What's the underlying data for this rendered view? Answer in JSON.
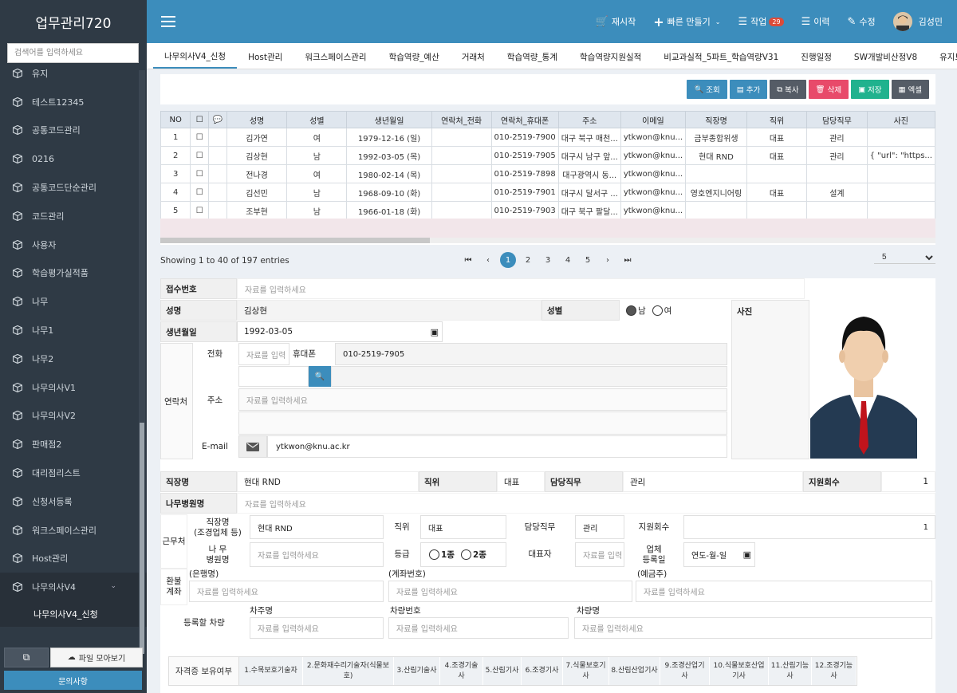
{
  "app": {
    "title": "업무관리720",
    "search_placeholder": "검색어를 입력하세요"
  },
  "sidebar": {
    "items": [
      {
        "label": "유지"
      },
      {
        "label": "테스트12345"
      },
      {
        "label": "공통코드관리"
      },
      {
        "label": "0216"
      },
      {
        "label": "공통코드단순관리"
      },
      {
        "label": "코드관리"
      },
      {
        "label": "사용자"
      },
      {
        "label": "학습평가실적품"
      },
      {
        "label": "나무"
      },
      {
        "label": "나무1"
      },
      {
        "label": "나무2"
      },
      {
        "label": "나무의사V1"
      },
      {
        "label": "나무의사V2"
      },
      {
        "label": "판매점2"
      },
      {
        "label": "대리점리스트"
      },
      {
        "label": "신청서등록"
      },
      {
        "label": "워크스페이스관리"
      },
      {
        "label": "Host관리"
      },
      {
        "label": "나무의사V4"
      }
    ],
    "subitem": "나무의사V4_신청",
    "file_button": "파일 모아보기",
    "inquiry_button": "문의사항"
  },
  "topbar": {
    "restart": "재시작",
    "quick_create": "빠른 만들기",
    "tasks": "작업",
    "tasks_count": "29",
    "history": "이력",
    "edit": "수정",
    "user": "김성민"
  },
  "tabs": [
    "나무의사V4_신청",
    "Host관리",
    "워크스페이스관리",
    "학습역량_예산",
    "거래처",
    "학습역량_통계",
    "학습역량지원실적",
    "비교과실적_5파트_학습역량V31",
    "진행일정",
    "SW개발비산정V8",
    "유지보수"
  ],
  "toolbar": {
    "search": "조회",
    "add": "추가",
    "copy": "복사",
    "delete": "삭제",
    "save": "저장",
    "excel": "엑셀"
  },
  "colors": {
    "search": "#3c8dbc",
    "add": "#3c8dbc",
    "copy": "#555c66",
    "delete": "#e84a6a",
    "save": "#20b28e",
    "excel": "#555c66"
  },
  "grid": {
    "columns": [
      "NO",
      "☐",
      "💬",
      "성명",
      "성별",
      "생년월일",
      "연락처_전화",
      "연락처_휴대폰",
      "주소",
      "이메일",
      "직장명",
      "직위",
      "담당직무",
      "사진"
    ],
    "rows": [
      [
        "1",
        "☐",
        "",
        "김가연",
        "여",
        "1979-12-16 (일)",
        "",
        "010-2519-7900",
        "대구 북구 매천...",
        "ytkwon@knu...",
        "금부종합위생",
        "대표",
        "관리",
        ""
      ],
      [
        "2",
        "☐",
        "",
        "김상현",
        "남",
        "1992-03-05 (목)",
        "",
        "010-2519-7905",
        "대구시 남구 앞...",
        "ytkwon@knu...",
        "현대 RND",
        "대표",
        "관리",
        "{ \"url\": \"https..."
      ],
      [
        "3",
        "☐",
        "",
        "전나경",
        "여",
        "1980-02-14 (목)",
        "",
        "010-2519-7898",
        "대구광역시 동...",
        "ytkwon@knu...",
        "",
        "",
        "",
        ""
      ],
      [
        "4",
        "☐",
        "",
        "김선민",
        "남",
        "1968-09-10 (화)",
        "",
        "010-2519-7901",
        "대구시 달서구 ...",
        "ytkwon@knu...",
        "영호엔지니어링",
        "대표",
        "설계",
        ""
      ],
      [
        "5",
        "☐",
        "",
        "조부현",
        "남",
        "1966-01-18 (화)",
        "",
        "010-2519-7903",
        "대구 북구 팔달...",
        "ytkwon@knu...",
        "",
        "",
        "",
        ""
      ]
    ]
  },
  "pagination": {
    "summary": "Showing 1 to 40 of 197 entries",
    "pages": [
      "1",
      "2",
      "3",
      "4",
      "5"
    ],
    "current": "1",
    "page_size": "5"
  },
  "form": {
    "receipt_no_label": "접수번호",
    "placeholder": "자료를 입력하세요",
    "name_label": "성명",
    "name": "김상현",
    "gender_label": "성별",
    "gender_male": "남",
    "gender_female": "여",
    "photo_label": "사진",
    "birth_label": "생년월일",
    "birth": "1992-03-05",
    "contact_label": "연락처",
    "phone_label": "전화",
    "phone_placeholder": "자료를 입력",
    "mobile_label": "휴대폰",
    "mobile": "010-2519-7905",
    "address_label": "주소",
    "email_label": "E-mail",
    "email": "ytkwon@knu.ac.kr",
    "workplace_label": "직장명",
    "workplace": "현대  RND",
    "position_label": "직위",
    "position": "대표",
    "duty_label": "담당직무",
    "duty": "관리",
    "support_count_label": "지원회수",
    "support_count": "1",
    "hospital_label": "나무병원명",
    "work_label": "근무처",
    "work_workplace_label": "직장명\n(조경업체 등)",
    "work_hospital_label": "나 무\n병원명",
    "grade_label": "등급",
    "grade_1": "1종",
    "grade_2": "2종",
    "ceo_label": "대표자",
    "ceo_placeholder": "자료를 입력",
    "biz_reg_label": "업체\n등록일",
    "biz_reg_placeholder": "연도-월-일",
    "refund_label": "환불\n계좌",
    "bank_label": "(은행명)",
    "account_label": "(계좌번호)",
    "holder_label": "(예금주)",
    "vehicle_label": "등록할 차량",
    "owner_label": "차주명",
    "car_no_label": "차량번호",
    "car_name_label": "차량명",
    "qual_label": "자격증 보유여부",
    "qualifications": [
      "1.수목보호기술자",
      "2.문화재수리기술자(식물보호)",
      "3.산림기술사",
      "4.조경기술사",
      "5.산림기사",
      "6.조경기사",
      "7.식물보호기사",
      "8.산림산업기사",
      "9.조경산업기사",
      "10.식물보호산업기사",
      "11.산림기능사",
      "12.조경기능사"
    ]
  }
}
